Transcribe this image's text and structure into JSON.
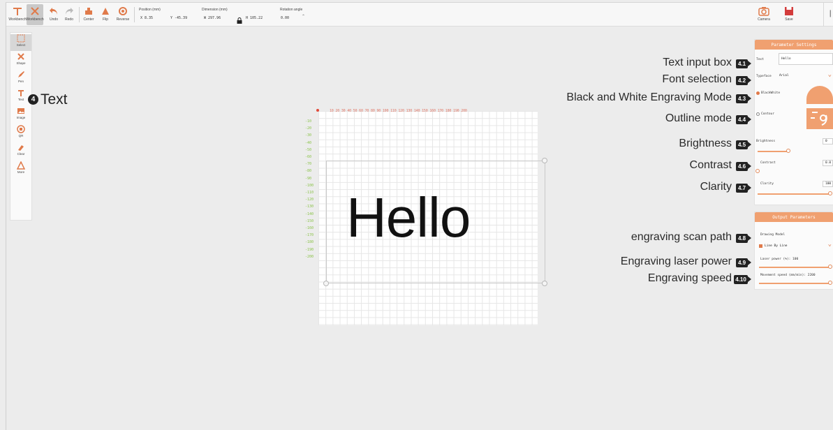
{
  "toolbar": {
    "tools": [
      {
        "label": "Workbench"
      },
      {
        "label": "Workbench"
      },
      {
        "label": "Undo"
      },
      {
        "label": "Redo"
      },
      {
        "label": "Center"
      },
      {
        "label": "Flip"
      },
      {
        "label": "Reverse"
      }
    ],
    "position": {
      "label": "Position (mm)",
      "x": "X 8.35",
      "y": "Y -45.39"
    },
    "dimension": {
      "label": "Dimension (mm)",
      "w": "W 297.96",
      "h": "H 105.22"
    },
    "rotation": {
      "label": "Rotation angle",
      "value": "0.00"
    },
    "camera_label": "Camera",
    "save_label": "Save"
  },
  "sidebar": {
    "items": [
      {
        "label": "Select"
      },
      {
        "label": "Shape"
      },
      {
        "label": "Pen"
      },
      {
        "label": "Text"
      },
      {
        "label": "Image"
      },
      {
        "label": "QR"
      },
      {
        "label": "Clear"
      },
      {
        "label": "More"
      }
    ]
  },
  "section": {
    "number": "4",
    "title": "Text"
  },
  "canvas": {
    "ruler_top": "10 20 30 40 50 60 70 80 90 100 110 120 130 140 150 160 170 180 190 200",
    "ruler_left": [
      "-10",
      "-20",
      "-30",
      "-40",
      "-50",
      "-60",
      "-70",
      "-80",
      "-90",
      "-100",
      "-110",
      "-120",
      "-130",
      "-140",
      "-150",
      "-160",
      "-170",
      "-180",
      "-190",
      "-200"
    ],
    "text": "Hello"
  },
  "callouts": [
    {
      "badge": "4.1",
      "text": "Text input box"
    },
    {
      "badge": "4.2",
      "text": "Font selection"
    },
    {
      "badge": "4.3",
      "text": "Black and White Engraving Mode"
    },
    {
      "badge": "4.4",
      "text": "Outline mode"
    },
    {
      "badge": "4.5",
      "text": "Brightness"
    },
    {
      "badge": "4.6",
      "text": "Contrast"
    },
    {
      "badge": "4.7",
      "text": "Clarity"
    },
    {
      "badge": "4.8",
      "text": "engraving scan path"
    },
    {
      "badge": "4.9",
      "text": "Engraving laser power"
    },
    {
      "badge": "4.10",
      "text": "Engraving speed"
    }
  ],
  "params": {
    "title": "Parameter Settings",
    "text_label": "Text",
    "text_value": "Hello",
    "typeface_label": "Typeface",
    "typeface_value": "Arial",
    "bw_label": "BlackWhite",
    "contour_label": "Contour",
    "brightness_label": "Brightness",
    "brightness_value": "0",
    "brightness_level": 0.42,
    "contrast_label": "Contrast",
    "contrast_value": "0.0",
    "contrast_level": 0.0,
    "clarity_label": "Clarity",
    "clarity_value": "100",
    "clarity_level": 1.0
  },
  "output": {
    "title": "Output Parameters",
    "mode_label": "Drawing Model",
    "mode_value": "Line By Line",
    "power_label": "Laser power (%): 100",
    "power_level": 1.0,
    "speed_label": "Movement speed (mm/min): 2200",
    "speed_level": 1.0
  },
  "colors": {
    "accent": "#f0a070",
    "badge": "#222222",
    "ruler_top": "#e07a6a",
    "ruler_left": "#8bc34a"
  }
}
